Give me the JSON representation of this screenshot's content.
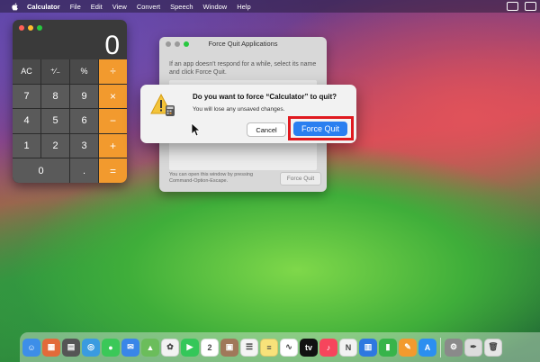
{
  "menubar": {
    "apple_icon": "apple-icon",
    "items": [
      "Calculator",
      "File",
      "Edit",
      "View",
      "Convert",
      "Speech",
      "Window",
      "Help"
    ]
  },
  "calculator": {
    "display": "0",
    "keys": [
      {
        "label": "AC",
        "kind": "fn"
      },
      {
        "label": "⁺∕₋",
        "kind": "fn"
      },
      {
        "label": "%",
        "kind": "fn"
      },
      {
        "label": "÷",
        "kind": "op"
      },
      {
        "label": "7",
        "kind": "num"
      },
      {
        "label": "8",
        "kind": "num"
      },
      {
        "label": "9",
        "kind": "num"
      },
      {
        "label": "×",
        "kind": "op"
      },
      {
        "label": "4",
        "kind": "num"
      },
      {
        "label": "5",
        "kind": "num"
      },
      {
        "label": "6",
        "kind": "num"
      },
      {
        "label": "−",
        "kind": "op"
      },
      {
        "label": "1",
        "kind": "num"
      },
      {
        "label": "2",
        "kind": "num"
      },
      {
        "label": "3",
        "kind": "num"
      },
      {
        "label": "+",
        "kind": "op"
      },
      {
        "label": "0",
        "kind": "num"
      },
      {
        "label": ".",
        "kind": "num"
      },
      {
        "label": "=",
        "kind": "op"
      }
    ]
  },
  "force_quit_window": {
    "title": "Force Quit Applications",
    "description": "If an app doesn't respond for a while, select its name and click Force Quit.",
    "footer": "You can open this window by pressing Command-Option-Escape.",
    "button": "Force Quit"
  },
  "alert": {
    "question": "Do you want to force “Calculator” to quit?",
    "message": "You will lose any unsaved changes.",
    "cancel_label": "Cancel",
    "force_label": "Force Quit"
  },
  "colors": {
    "accent_blue": "#2a7ff0",
    "highlight_red": "#e0191f",
    "calc_orange": "#f29a2e"
  },
  "dock": {
    "items": [
      {
        "name": "finder-icon",
        "color": "#3d8ee8",
        "glyph": "☺"
      },
      {
        "name": "launchpad-icon",
        "color": "#e26a3a",
        "glyph": "▦"
      },
      {
        "name": "calculator-app-icon",
        "color": "#555555",
        "glyph": "▤"
      },
      {
        "name": "safari-icon",
        "color": "#3a9be0",
        "glyph": "◎"
      },
      {
        "name": "messages-icon",
        "color": "#3bc858",
        "glyph": "●"
      },
      {
        "name": "mail-icon",
        "color": "#3a86e8",
        "glyph": "✉"
      },
      {
        "name": "maps-icon",
        "color": "#6bbd5b",
        "glyph": "▲"
      },
      {
        "name": "photos-icon",
        "color": "#f2f2f2",
        "glyph": "✿"
      },
      {
        "name": "facetime-icon",
        "color": "#34c759",
        "glyph": "▶"
      },
      {
        "name": "calendar-icon",
        "color": "#ffffff",
        "glyph": "2"
      },
      {
        "name": "contacts-icon",
        "color": "#a0785a",
        "glyph": "▣"
      },
      {
        "name": "reminders-icon",
        "color": "#f4f4f4",
        "glyph": "☰"
      },
      {
        "name": "notes-icon",
        "color": "#f8e27a",
        "glyph": "≡"
      },
      {
        "name": "freeform-icon",
        "color": "#ffffff",
        "glyph": "∿"
      },
      {
        "name": "apple-tv-icon",
        "color": "#111111",
        "glyph": "tv"
      },
      {
        "name": "music-icon",
        "color": "#f6455c",
        "glyph": "♪"
      },
      {
        "name": "news-icon",
        "color": "#f2f2f2",
        "glyph": "N"
      },
      {
        "name": "keynote-icon",
        "color": "#2e78e0",
        "glyph": "▥"
      },
      {
        "name": "numbers-icon",
        "color": "#37b44a",
        "glyph": "▮"
      },
      {
        "name": "pages-icon",
        "color": "#f29a2e",
        "glyph": "✎"
      },
      {
        "name": "app-store-icon",
        "color": "#2b8ff0",
        "glyph": "A"
      },
      {
        "name": "system-settings-icon",
        "color": "#8a8a8a",
        "glyph": "⚙"
      },
      {
        "name": "script-editor-icon",
        "color": "#dcdcdc",
        "glyph": "✒"
      },
      {
        "name": "trash-icon",
        "color": "#e6e6e6",
        "glyph": "🗑"
      }
    ]
  }
}
